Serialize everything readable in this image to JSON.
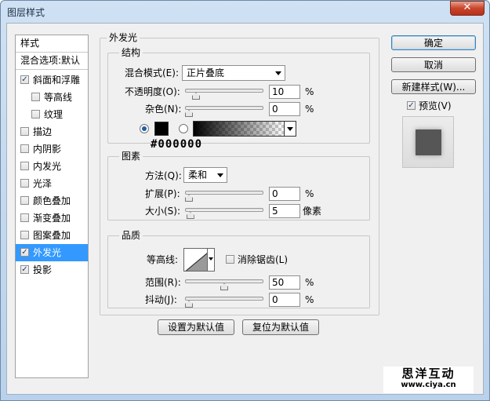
{
  "window": {
    "title": "图层样式",
    "close_label": "✕"
  },
  "style_list": {
    "header": "样式",
    "blend_default": "混合选项:默认",
    "items": [
      {
        "label": "斜面和浮雕",
        "checked": true
      },
      {
        "label": "等高线",
        "checked": false
      },
      {
        "label": "纹理",
        "checked": false
      },
      {
        "label": "描边",
        "checked": false
      },
      {
        "label": "内阴影",
        "checked": false
      },
      {
        "label": "内发光",
        "checked": false
      },
      {
        "label": "光泽",
        "checked": false
      },
      {
        "label": "颜色叠加",
        "checked": false
      },
      {
        "label": "渐变叠加",
        "checked": false
      },
      {
        "label": "图案叠加",
        "checked": false
      },
      {
        "label": "外发光",
        "checked": true
      },
      {
        "label": "投影",
        "checked": true
      }
    ]
  },
  "panel": {
    "title": "外发光",
    "structure": {
      "label": "结构",
      "blend_mode_label": "混合模式(E):",
      "blend_mode_value": "正片叠底",
      "opacity_label": "不透明度(O):",
      "opacity_value": "10",
      "opacity_unit": "%",
      "opacity_fraction": 0.1,
      "noise_label": "杂色(N):",
      "noise_value": "0",
      "noise_unit": "%",
      "noise_fraction": 0,
      "color_hex": "#000000",
      "color_swatch": "#000000"
    },
    "elements": {
      "label": "图素",
      "method_label": "方法(Q):",
      "method_value": "柔和",
      "spread_label": "扩展(P):",
      "spread_value": "0",
      "spread_unit": "%",
      "spread_fraction": 0,
      "size_label": "大小(S):",
      "size_value": "5",
      "size_unit": "像素",
      "size_fraction": 0.02
    },
    "quality": {
      "label": "品质",
      "contour_label": "等高线:",
      "antialias_label": "消除锯齿(L)",
      "range_label": "范围(R):",
      "range_value": "50",
      "range_unit": "%",
      "range_fraction": 0.5,
      "jitter_label": "抖动(J):",
      "jitter_value": "0",
      "jitter_unit": "%",
      "jitter_fraction": 0
    },
    "set_default_label": "设置为默认值",
    "reset_default_label": "复位为默认值"
  },
  "buttons": {
    "ok": "确定",
    "cancel": "取消",
    "new_style": "新建样式(W)...",
    "preview": "预览(V)"
  },
  "watermark": {
    "line1": "思洋互动",
    "line2": "www.ciya.cn"
  }
}
